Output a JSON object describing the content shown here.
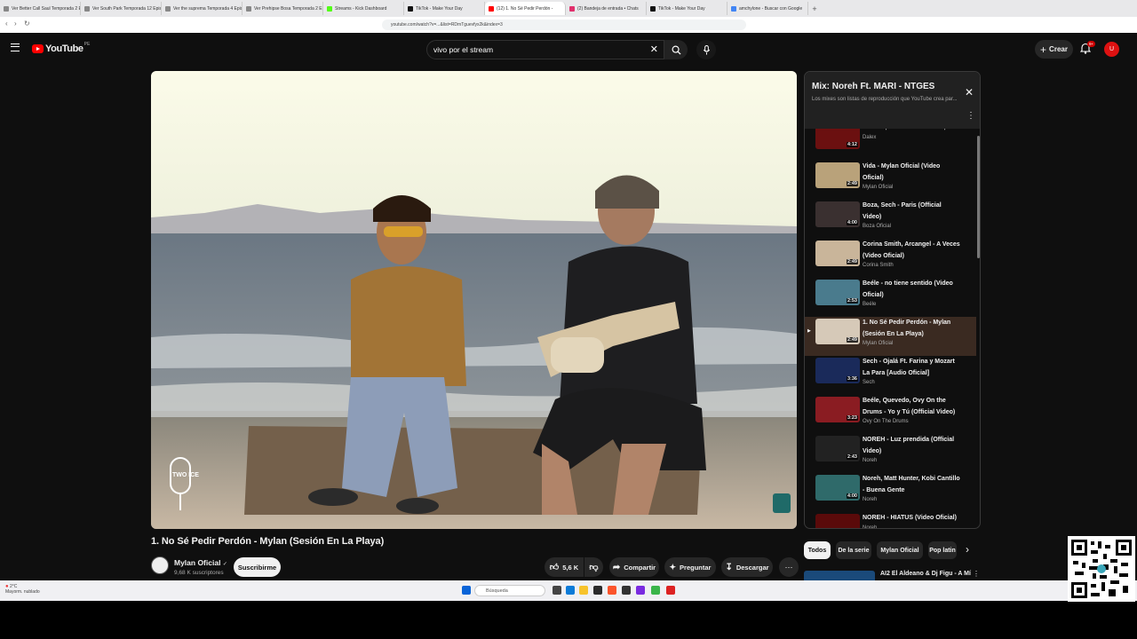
{
  "browser": {
    "tabs": [
      {
        "label": "Ver Better Call Saul Temporada 2 Ep...",
        "color": "#888"
      },
      {
        "label": "Ver South Park Temporada 12 Episo...",
        "color": "#888"
      },
      {
        "label": "Ver the suprema Temporada 4 Episo...",
        "color": "#888"
      },
      {
        "label": "Ver Prehipse Bosa Temporada 2 Episo...",
        "color": "#888"
      },
      {
        "label": "Streams - Kick Dashboard",
        "color": "#53fc18"
      },
      {
        "label": "TikTok - Make Your Day",
        "color": "#111"
      },
      {
        "label": "(12) 1. No Sé Pedir Perdón - ",
        "color": "#ff0000",
        "active": true
      },
      {
        "label": "(2) Bandeja de entrada • Chats",
        "color": "#e1306c"
      },
      {
        "label": "TikTok - Make Your Day",
        "color": "#111"
      },
      {
        "label": "amchylone - Buscar con Google",
        "color": "#4285f4"
      }
    ],
    "new_tab": "+",
    "address": "youtube.com/watch?v=...&list=RDmTguevfyx2k&index=3"
  },
  "masthead": {
    "logo_text": "YouTube",
    "country_code": "PE",
    "search_value": "vivo por el stream",
    "create_label": "Crear",
    "notif_count": "9+",
    "avatar_letter": "U"
  },
  "video": {
    "title": "1. No Sé Pedir Perdón - Mylan (Sesión En La Playa)",
    "channel": "Mylan Oficial",
    "subscribers": "9,68 K suscriptores",
    "subscribe_label": "Suscribirme",
    "likes": "5,6 K",
    "share_label": "Compartir",
    "ask_label": "Preguntar",
    "download_label": "Descargar",
    "watermark": "TWO ICE"
  },
  "playlist": {
    "title": "Mix: Noreh Ft. MARI - NTGES",
    "subtitle": "Los mixes son listas de reproducción que YouTube crea par...",
    "items": [
      {
        "title": "Tavárez, Chencho Corleone,...",
        "channel": "Dalex",
        "duration": "4:12",
        "color": "#6b1010"
      },
      {
        "title": "Vida - Mylan Oficial (Video Oficial)",
        "channel": "Mylan Oficial",
        "duration": "2:49",
        "color": "#b9a27a"
      },
      {
        "title": "Boza, Sech - Paris (Official Video)",
        "channel": "Boza Oficial",
        "duration": "4:00",
        "color": "#3a3030"
      },
      {
        "title": "Corina Smith, Arcangel - A Veces (Video Oficial)",
        "channel": "Corina Smith",
        "duration": "2:49",
        "color": "#c9b59a"
      },
      {
        "title": "Beéle - no tiene sentido (Video Oficial)",
        "channel": "Beéle",
        "duration": "2:53",
        "color": "#4a7b8d"
      },
      {
        "title": "1. No Sé Pedir Perdón - Mylan (Sesión En La Playa)",
        "channel": "Mylan Oficial",
        "duration": "2:49",
        "color": "#d6c9b8",
        "active": true
      },
      {
        "title": "Sech - Ojalá Ft. Farina y Mozart La Para [Audio Oficial]",
        "channel": "Sech",
        "duration": "3:36",
        "color": "#1a2a5a"
      },
      {
        "title": "Beéle, Quevedo, Ovy On the Drums - Yo y Tú (Official Video)",
        "channel": "Ovy On The Drums",
        "duration": "3:23",
        "color": "#8a1c22"
      },
      {
        "title": "NOREH - Luz prendida (Official Video)",
        "channel": "Noreh",
        "duration": "2:43",
        "color": "#222"
      },
      {
        "title": "Noreh, Matt Hunter, Kobi Cantillo - Buena Gente",
        "channel": "Noreh",
        "duration": "4:00",
        "color": "#2f6a6a"
      },
      {
        "title": "NOREH - HIATUS (Video Oficial)",
        "channel": "Noreh",
        "duration": "3:21",
        "color": "#5a0a0a"
      }
    ]
  },
  "chips": [
    "Todos",
    "De la serie",
    "Mylan Oficial",
    "Pop latin"
  ],
  "recommendation": {
    "title": "AI2 El Aldeano & Dj Figu - A Mí"
  },
  "taskbar": {
    "weather_temp": "2°C",
    "weather_text": "Mayorm. nublado",
    "search_placeholder": "Búsqueda"
  }
}
